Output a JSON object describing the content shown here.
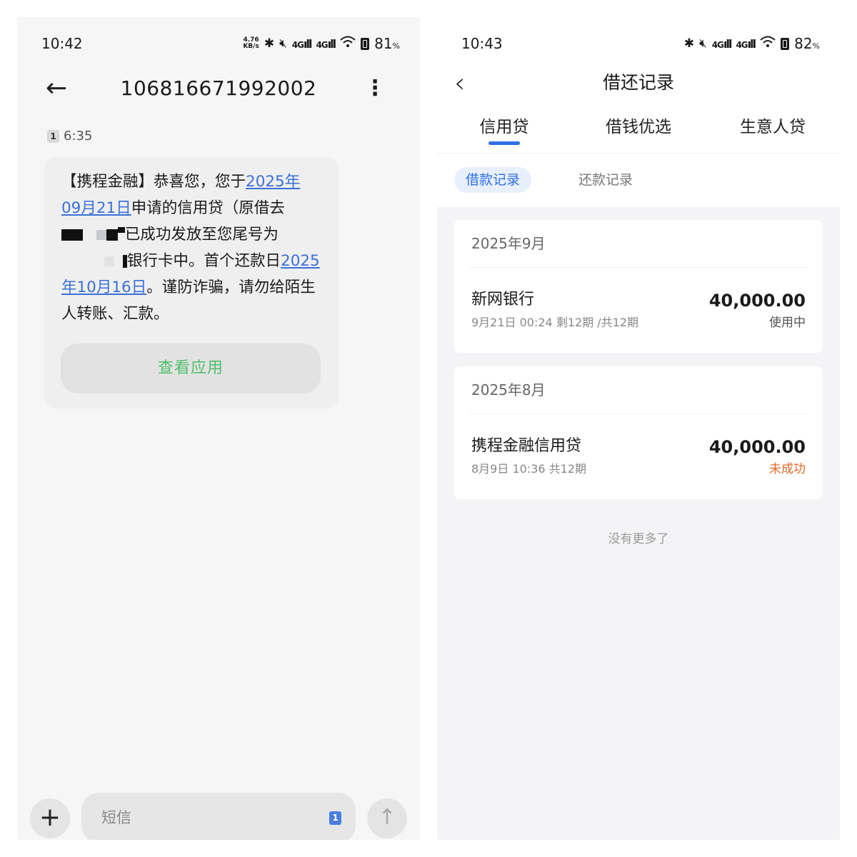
{
  "left": {
    "status": {
      "time": "10:42",
      "netspeed_value": "4.76",
      "netspeed_unit": "KB/s",
      "signal1": "4G",
      "signal2": "4G",
      "battery": "81",
      "battery_unit": "%"
    },
    "header": {
      "back_icon": "arrow-left-icon",
      "sender": "106816671992002",
      "more_icon": "more-vertical-icon"
    },
    "message": {
      "sim": "1",
      "time": "6:35",
      "p1": "【携程金融】恭喜您，您于",
      "link1a": "2025年",
      "link1b": "09月21日",
      "p2": "申请的信用贷（原借去",
      "p3": "已成功发放至您尾号为",
      "p4": "银行卡中。首个还款日",
      "link2a": "2025",
      "link2b": "年10月16日",
      "p5": "。谨防诈骗，请勿给陌生人转账、汇款。",
      "action": "查看应用"
    },
    "compose": {
      "plus": "+",
      "placeholder": "短信",
      "sim": "1",
      "send_icon": "↑"
    }
  },
  "right": {
    "status": {
      "time": "10:43",
      "signal1": "4G",
      "signal2": "4G",
      "battery": "82",
      "battery_unit": "%"
    },
    "nav": {
      "back": "‹",
      "title": "借还记录"
    },
    "tabs": [
      "信用贷",
      "借钱优选",
      "生意人贷"
    ],
    "subtabs": [
      "借款记录",
      "还款记录"
    ],
    "records": [
      {
        "month": "2025年9月",
        "name": "新网银行",
        "meta": "9月21日 00:24 剩12期 /共12期",
        "amount": "40,000.00",
        "status": "使用中",
        "status_color": "#555555"
      },
      {
        "month": "2025年8月",
        "name": "携程金融信用贷",
        "meta": "8月9日 10:36 共12期",
        "amount": "40,000.00",
        "status": "未成功",
        "status_color": "#e06a28"
      }
    ],
    "footer": "没有更多了"
  }
}
